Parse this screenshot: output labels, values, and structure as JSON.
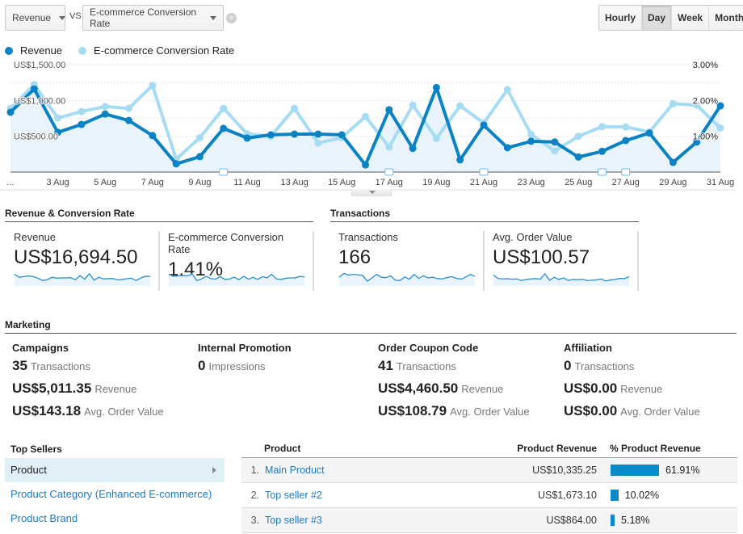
{
  "controls": {
    "metric1": "Revenue",
    "vs_label": "VS",
    "metric2": "E-commerce Conversion Rate",
    "granularity": [
      "Hourly",
      "Day",
      "Week",
      "Month"
    ],
    "granularity_active": "Day"
  },
  "legend": [
    {
      "label": "Revenue",
      "color": "#0a82c4"
    },
    {
      "label": "E-commerce Conversion Rate",
      "color": "#a6dcf3"
    }
  ],
  "chart_data": {
    "type": "line",
    "x": [
      "1 Aug",
      "2 Aug",
      "3 Aug",
      "4 Aug",
      "5 Aug",
      "6 Aug",
      "7 Aug",
      "8 Aug",
      "9 Aug",
      "10 Aug",
      "11 Aug",
      "12 Aug",
      "13 Aug",
      "14 Aug",
      "15 Aug",
      "16 Aug",
      "17 Aug",
      "18 Aug",
      "19 Aug",
      "20 Aug",
      "21 Aug",
      "22 Aug",
      "23 Aug",
      "24 Aug",
      "25 Aug",
      "26 Aug",
      "27 Aug",
      "28 Aug",
      "29 Aug",
      "30 Aug",
      "31 Aug"
    ],
    "xtick_labels": [
      "...",
      "3 Aug",
      "5 Aug",
      "7 Aug",
      "9 Aug",
      "11 Aug",
      "13 Aug",
      "15 Aug",
      "17 Aug",
      "19 Aug",
      "21 Aug",
      "23 Aug",
      "25 Aug",
      "27 Aug",
      "29 Aug",
      "31 Aug"
    ],
    "series": [
      {
        "name": "Revenue",
        "axis": "left",
        "color": "#0a82c4",
        "values": [
          835,
          1160,
          555,
          665,
          810,
          720,
          510,
          115,
          215,
          610,
          475,
          520,
          530,
          530,
          520,
          100,
          870,
          330,
          1180,
          170,
          655,
          340,
          430,
          420,
          210,
          290,
          440,
          545,
          135,
          420,
          925
        ]
      },
      {
        "name": "E-commerce Conversion Rate",
        "axis": "right",
        "color": "#a6dcf3",
        "values": [
          1.78,
          2.44,
          1.51,
          1.69,
          1.83,
          1.78,
          2.42,
          0.36,
          0.96,
          1.78,
          1.07,
          1.0,
          1.78,
          0.81,
          0.96,
          1.55,
          0.7,
          1.87,
          0.94,
          1.85,
          1.37,
          2.3,
          1.05,
          0.59,
          1.0,
          1.27,
          1.26,
          1.12,
          1.91,
          1.87,
          1.23
        ]
      }
    ],
    "left_ticks": [
      "US$500.00",
      "US$1,000.00",
      "US$1,500.00"
    ],
    "right_ticks": [
      "1.00%",
      "2.00%",
      "3.00%"
    ],
    "ylim_left": [
      0,
      1500
    ],
    "ylim_right": [
      0,
      3
    ],
    "annotation_days": [
      10,
      17,
      21,
      26,
      27
    ],
    "grid": true
  },
  "sections": {
    "rev_conv": "Revenue & Conversion Rate",
    "transactions": "Transactions",
    "marketing": "Marketing",
    "top_sellers": "Top Sellers"
  },
  "tiles": [
    {
      "label": "Revenue",
      "value": "US$16,694.50",
      "spark": [
        0.78,
        0.55,
        0.6,
        0.66,
        0.6,
        0.48,
        0.3,
        0.36,
        0.55,
        0.48,
        0.5,
        0.5,
        0.52,
        0.35,
        0.68,
        0.4,
        0.82,
        0.32,
        0.55,
        0.42,
        0.44,
        0.45,
        0.35,
        0.38,
        0.44,
        0.48,
        0.3,
        0.5,
        0.62,
        0.62
      ]
    },
    {
      "label": "E-commerce Conversion Rate",
      "value": "1.41%",
      "spark": [
        0.78,
        0.62,
        0.66,
        0.68,
        0.66,
        0.8,
        0.3,
        0.42,
        0.62,
        0.45,
        0.4,
        0.6,
        0.38,
        0.42,
        0.56,
        0.36,
        0.62,
        0.4,
        0.55,
        0.38,
        0.6,
        0.5,
        0.78,
        0.42,
        0.38,
        0.48,
        0.5,
        0.5,
        0.62,
        0.58
      ]
    },
    {
      "label": "Transactions",
      "value": "166",
      "spark": [
        0.55,
        0.85,
        0.72,
        0.78,
        0.74,
        0.7,
        0.25,
        0.5,
        0.78,
        0.55,
        0.52,
        0.66,
        0.32,
        0.3,
        0.58,
        0.4,
        0.78,
        0.46,
        0.66,
        0.5,
        0.55,
        0.44,
        0.42,
        0.52,
        0.6,
        0.48,
        0.4,
        0.55,
        0.78,
        0.62
      ]
    },
    {
      "label": "Avg. Order Value",
      "value": "US$100.57",
      "spark": [
        0.72,
        0.45,
        0.42,
        0.44,
        0.4,
        0.42,
        0.3,
        0.38,
        0.42,
        0.45,
        0.4,
        0.82,
        0.32,
        0.55,
        0.38,
        0.5,
        0.3,
        0.38,
        0.36,
        0.4,
        0.3,
        0.32,
        0.34,
        0.42,
        0.26,
        0.34,
        0.38,
        0.46,
        0.44,
        0.6
      ]
    }
  ],
  "marketing": [
    {
      "title": "Campaigns",
      "rows": [
        {
          "value": "35",
          "label": "Transactions"
        },
        {
          "value": "US$5,011.35",
          "label": "Revenue"
        },
        {
          "value": "US$143.18",
          "label": "Avg. Order Value"
        }
      ]
    },
    {
      "title": "Internal Promotion",
      "rows": [
        {
          "value": "0",
          "label": "Impressions"
        }
      ]
    },
    {
      "title": "Order Coupon Code",
      "rows": [
        {
          "value": "41",
          "label": "Transactions"
        },
        {
          "value": "US$4,460.50",
          "label": "Revenue"
        },
        {
          "value": "US$108.79",
          "label": "Avg. Order Value"
        }
      ]
    },
    {
      "title": "Affiliation",
      "rows": [
        {
          "value": "0",
          "label": "Transactions"
        },
        {
          "value": "US$0.00",
          "label": "Revenue"
        },
        {
          "value": "US$0.00",
          "label": "Avg. Order Value"
        }
      ]
    }
  ],
  "top_sellers": {
    "items": [
      "Product",
      "Product Category (Enhanced E-commerce)",
      "Product Brand"
    ],
    "active": "Product"
  },
  "product_table": {
    "headers": [
      "Product",
      "Product Revenue",
      "% Product Revenue"
    ],
    "rows": [
      {
        "rank": "1.",
        "name": "Main Product",
        "revenue": "US$10,335.25",
        "pct_label": "61.91%",
        "pct": 61.91
      },
      {
        "rank": "2.",
        "name": "Top seller #2",
        "revenue": "US$1,673.10",
        "pct_label": "10.02%",
        "pct": 10.02
      },
      {
        "rank": "3.",
        "name": "Top seller #3",
        "revenue": "US$864.00",
        "pct_label": "5.18%",
        "pct": 5.18
      }
    ]
  }
}
